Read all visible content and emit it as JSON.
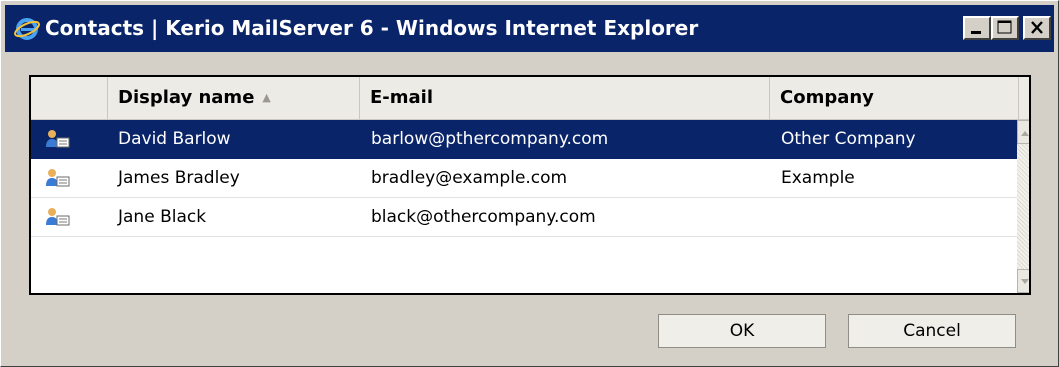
{
  "window": {
    "title": "Contacts | Kerio MailServer 6 - Windows Internet Explorer",
    "controls": [
      "minimize-icon",
      "maximize-icon",
      "close-icon"
    ]
  },
  "grid": {
    "columns": [
      {
        "label": "Display name",
        "sorted": "ascending"
      },
      {
        "label": "E-mail"
      },
      {
        "label": "Company"
      }
    ],
    "rows": [
      {
        "icon": "contact-card-icon",
        "name": "David Barlow",
        "email": "barlow@pthercompany.com",
        "company": "Other Company",
        "selected": true
      },
      {
        "icon": "contact-card-icon",
        "name": "James Bradley",
        "email": "bradley@example.com",
        "company": "Example",
        "selected": false
      },
      {
        "icon": "contact-card-icon",
        "name": "Jane Black",
        "email": "black@othercompany.com",
        "company": "",
        "selected": false
      }
    ]
  },
  "buttons": {
    "ok": "OK",
    "cancel": "Cancel"
  },
  "colors": {
    "selection": "#0a246a",
    "titlebar": "#0a246a",
    "dialog_bg": "#d4d0c8"
  }
}
